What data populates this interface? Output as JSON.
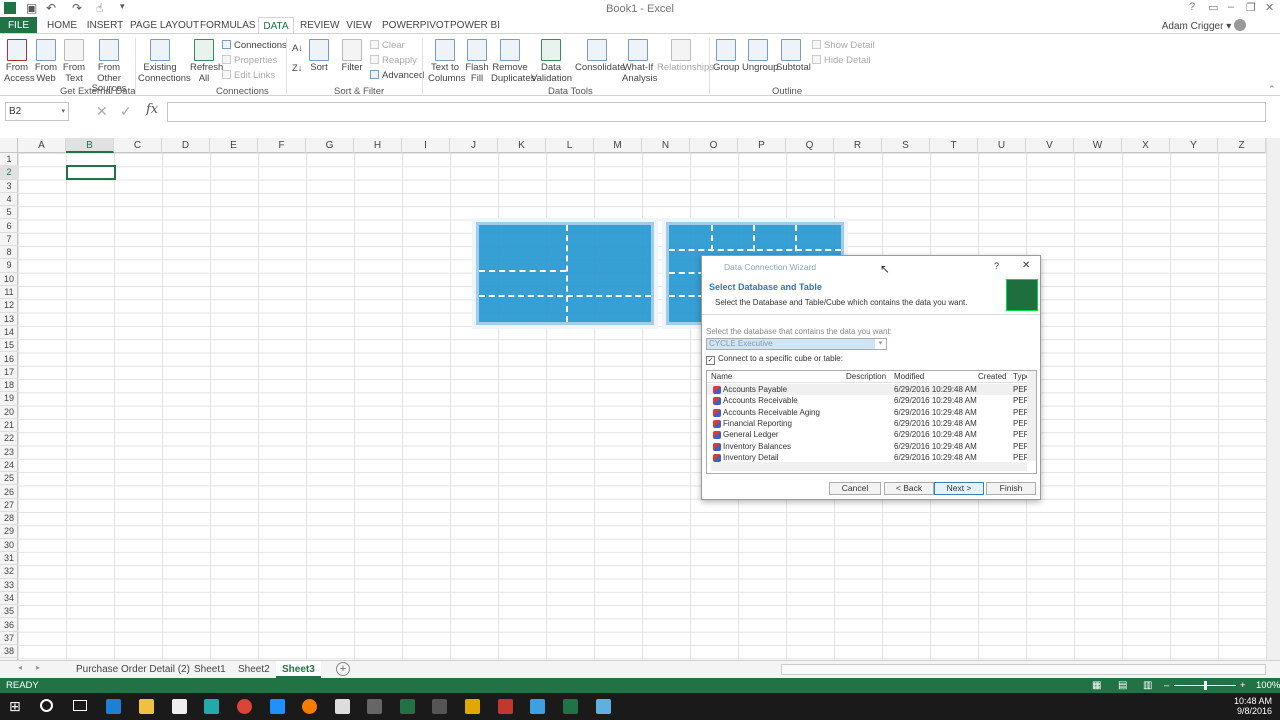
{
  "window": {
    "title": "Book1 - Excel",
    "user": "Adam Crigger"
  },
  "tabs": [
    "FILE",
    "HOME",
    "INSERT",
    "PAGE LAYOUT",
    "FORMULAS",
    "DATA",
    "REVIEW",
    "VIEW",
    "POWERPIVOT",
    "POWER BI"
  ],
  "ribbon": {
    "get_external": {
      "label": "Get External Data",
      "buttons": [
        "From Access",
        "From Web",
        "From Text",
        "From Other Sources"
      ]
    },
    "connections": {
      "label": "Connections",
      "existing": "Existing Connections",
      "refresh": "Refresh All",
      "small": [
        "Connections",
        "Properties",
        "Edit Links"
      ]
    },
    "sort_filter": {
      "label": "Sort & Filter",
      "sort": "Sort",
      "filter": "Filter",
      "small": [
        "Clear",
        "Reapply",
        "Advanced"
      ]
    },
    "data_tools": {
      "label": "Data Tools",
      "buttons": [
        "Text to Columns",
        "Flash Fill",
        "Remove Duplicates",
        "Data Validation",
        "Consolidate",
        "What-If Analysis",
        "Relationships"
      ]
    },
    "outline": {
      "label": "Outline",
      "buttons": [
        "Group",
        "Ungroup",
        "Subtotal"
      ],
      "small": [
        "Show Detail",
        "Hide Detail"
      ]
    }
  },
  "formula_bar": {
    "name_box": "B2",
    "fx": "fx",
    "value": ""
  },
  "columns": [
    "A",
    "B",
    "C",
    "D",
    "E",
    "F",
    "G",
    "H",
    "I",
    "J",
    "K",
    "L",
    "M",
    "N",
    "O",
    "P",
    "Q",
    "R",
    "S",
    "T",
    "U",
    "V",
    "W",
    "X",
    "Y",
    "Z"
  ],
  "rows": [
    "1",
    "2",
    "3",
    "4",
    "5",
    "6",
    "7",
    "8",
    "9",
    "10",
    "11",
    "12",
    "13",
    "14",
    "15",
    "16",
    "17",
    "18",
    "19",
    "20",
    "21",
    "22",
    "23",
    "24",
    "25",
    "26",
    "27",
    "28",
    "29",
    "30",
    "31",
    "32",
    "33",
    "34",
    "35",
    "36",
    "37",
    "38"
  ],
  "sheet_tabs": [
    "Purchase Order Detail (2)",
    "Sheet1",
    "Sheet2",
    "Sheet3"
  ],
  "status": {
    "ready": "READY",
    "zoom": "100%"
  },
  "clock": {
    "time": "10:48 AM",
    "date": "9/8/2016"
  },
  "dialog": {
    "title": "Data Connection Wizard",
    "heading": "Select Database and Table",
    "subheading": "Select the Database and Table/Cube which contains the data you want.",
    "db_label": "Select the database that contains the data you want:",
    "db_value": "CYCLE Executive",
    "checkbox_label": "Connect to a specific cube or table:",
    "columns": [
      "Name",
      "Description",
      "Modified",
      "Created",
      "Type"
    ],
    "rows": [
      {
        "name": "Accounts Payable",
        "modified": "6/29/2016 10:29:48 AM",
        "type": "PER"
      },
      {
        "name": "Accounts Receivable",
        "modified": "6/29/2016 10:29:48 AM",
        "type": "PER"
      },
      {
        "name": "Accounts Receivable Aging",
        "modified": "6/29/2016 10:29:48 AM",
        "type": "PER"
      },
      {
        "name": "Financial Reporting",
        "modified": "6/29/2016 10:29:48 AM",
        "type": "PER"
      },
      {
        "name": "General Ledger",
        "modified": "6/29/2016 10:29:48 AM",
        "type": "PER"
      },
      {
        "name": "Inventory Balances",
        "modified": "6/29/2016 10:29:48 AM",
        "type": "PER"
      },
      {
        "name": "Inventory Detail",
        "modified": "6/29/2016 10:29:48 AM",
        "type": "PER"
      }
    ],
    "buttons": {
      "cancel": "Cancel",
      "back": "< Back",
      "next": "Next >",
      "finish": "Finish"
    }
  }
}
